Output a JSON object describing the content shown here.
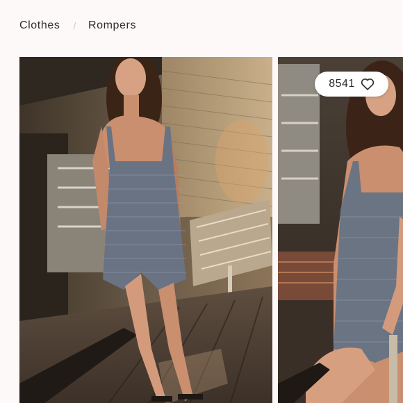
{
  "breadcrumb": {
    "items": [
      "Clothes",
      "Rompers"
    ],
    "separator": "/"
  },
  "products": [
    {
      "image_alt": "Woman wearing a gingham romper in a sunlit room"
    },
    {
      "image_alt": "Woman in a gingham romper sitting on a chair",
      "likes": "8541",
      "like_icon": "heart-outline-icon"
    }
  ]
}
